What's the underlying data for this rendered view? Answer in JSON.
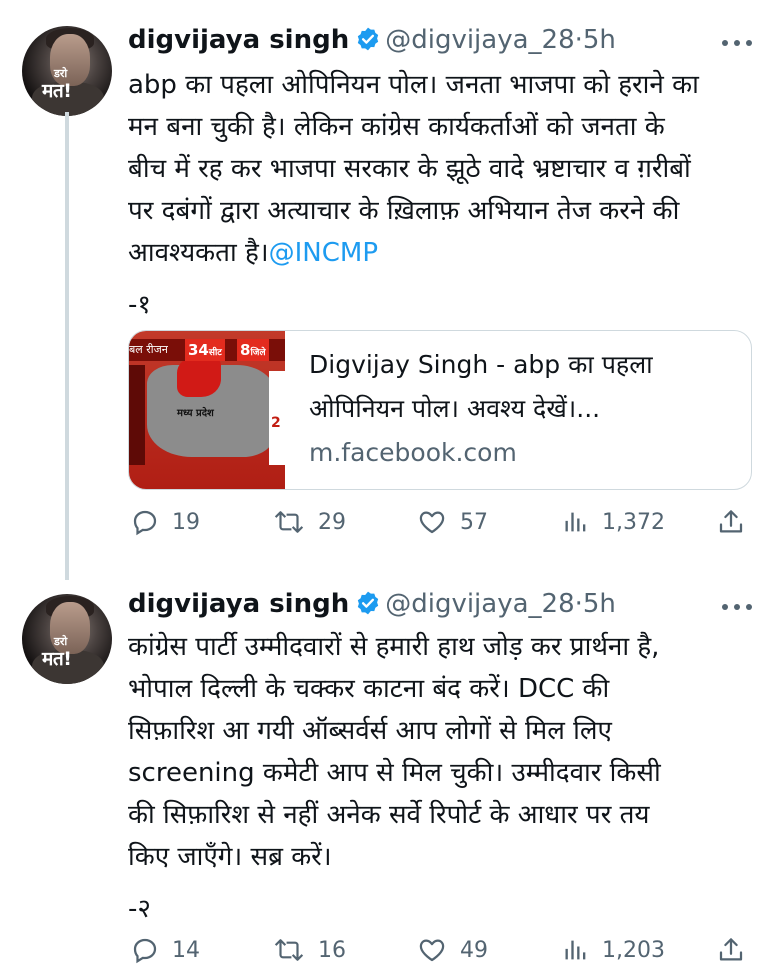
{
  "tweets": [
    {
      "name": "digvijaya singh",
      "handle": "@digvijaya_28",
      "separator": "·",
      "time": "5h",
      "avatar_small_text": "डरो",
      "avatar_big_text": "मत!",
      "text_lines": [
        "abp का पहला ओपिनियन पोल। जनता भाजपा को हराने का",
        "मन बना चुकी है। लेकिन कांग्रेस कार्यकर्ताओं को जनता के",
        "बीच में रह कर भाजपा सरकार के झूठे वादे भ्रष्टाचार व ग़रीबों",
        "पर दबंगों द्वारा अत्याचार के ख़िलाफ़ अभियान तेज करने की",
        "आवश्यकता है।"
      ],
      "mention": "@INCMP",
      "footer_line": "-१",
      "card": {
        "title_line1": "Digvijay Singh - abp का पहला",
        "title_line2": "ओपिनियन पोल। अवश्य देखें।...",
        "domain": "m.facebook.com",
        "thumb_bar_text": "बल रीजन",
        "thumb_num1": "34",
        "thumb_num1_sub": "सीट",
        "thumb_num2": "8",
        "thumb_num2_sub": "जिले",
        "thumb_map_label": "मध्य प्रदेश",
        "thumb_right_num": "2"
      },
      "replies": "19",
      "retweets": "29",
      "likes": "57",
      "views": "1,372"
    },
    {
      "name": "digvijaya singh",
      "handle": "@digvijaya_28",
      "separator": "·",
      "time": "5h",
      "avatar_small_text": "डरो",
      "avatar_big_text": "मत!",
      "text_lines": [
        "कांग्रेस पार्टी उम्मीदवारों से हमारी हाथ जोड़ कर प्रार्थना है,",
        "भोपाल दिल्ली के चक्कर काटना बंद करें। DCC की",
        "सिफ़ारिश आ गयी ऑब्सर्वर्स आप लोगों से मिल लिए",
        "screening कमेटी आप से मिल चुकी। उम्मीदवार किसी",
        "की सिफ़ारिश से नहीं अनेक सर्वे रिपोर्ट के आधार पर तय",
        "किए जाएँगे। सब्र करें।"
      ],
      "footer_line": "-२",
      "replies": "14",
      "retweets": "16",
      "likes": "49",
      "views": "1,203"
    }
  ],
  "colors": {
    "accent": "#1d9bf0",
    "text": "#0f1419",
    "secondary": "#536471",
    "border": "#cfd9de"
  }
}
